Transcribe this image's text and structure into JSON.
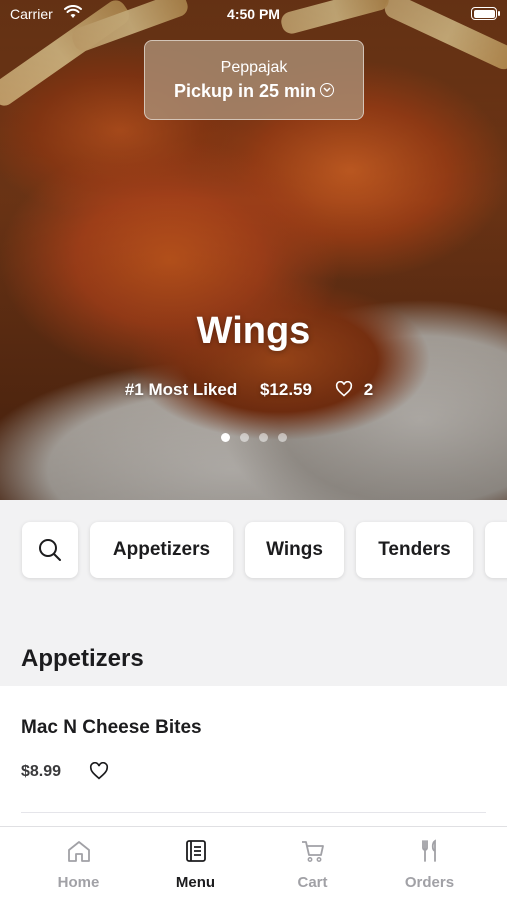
{
  "status_bar": {
    "carrier": "Carrier",
    "time": "4:50 PM"
  },
  "location": {
    "name": "Peppajak",
    "pickup": "Pickup in 25 min"
  },
  "hero": {
    "title": "Wings",
    "badge": "#1 Most Liked",
    "price": "$12.59",
    "likes": "2",
    "carousel_pages": 4,
    "active_page": 1
  },
  "categories": [
    {
      "label": "Appetizers"
    },
    {
      "label": "Wings"
    },
    {
      "label": "Tenders"
    }
  ],
  "section": {
    "title": "Appetizers",
    "items": [
      {
        "name": "Mac N Cheese Bites",
        "price": "$8.99"
      }
    ]
  },
  "tabs": [
    {
      "label": "Home",
      "icon": "home-icon",
      "active": false
    },
    {
      "label": "Menu",
      "icon": "menu-icon",
      "active": true
    },
    {
      "label": "Cart",
      "icon": "cart-icon",
      "active": false
    },
    {
      "label": "Orders",
      "icon": "orders-icon",
      "active": false
    }
  ],
  "colors": {
    "active_tab": "#1c1c1e",
    "inactive_tab": "#a1a1a6",
    "background": "#f2f2f3"
  }
}
